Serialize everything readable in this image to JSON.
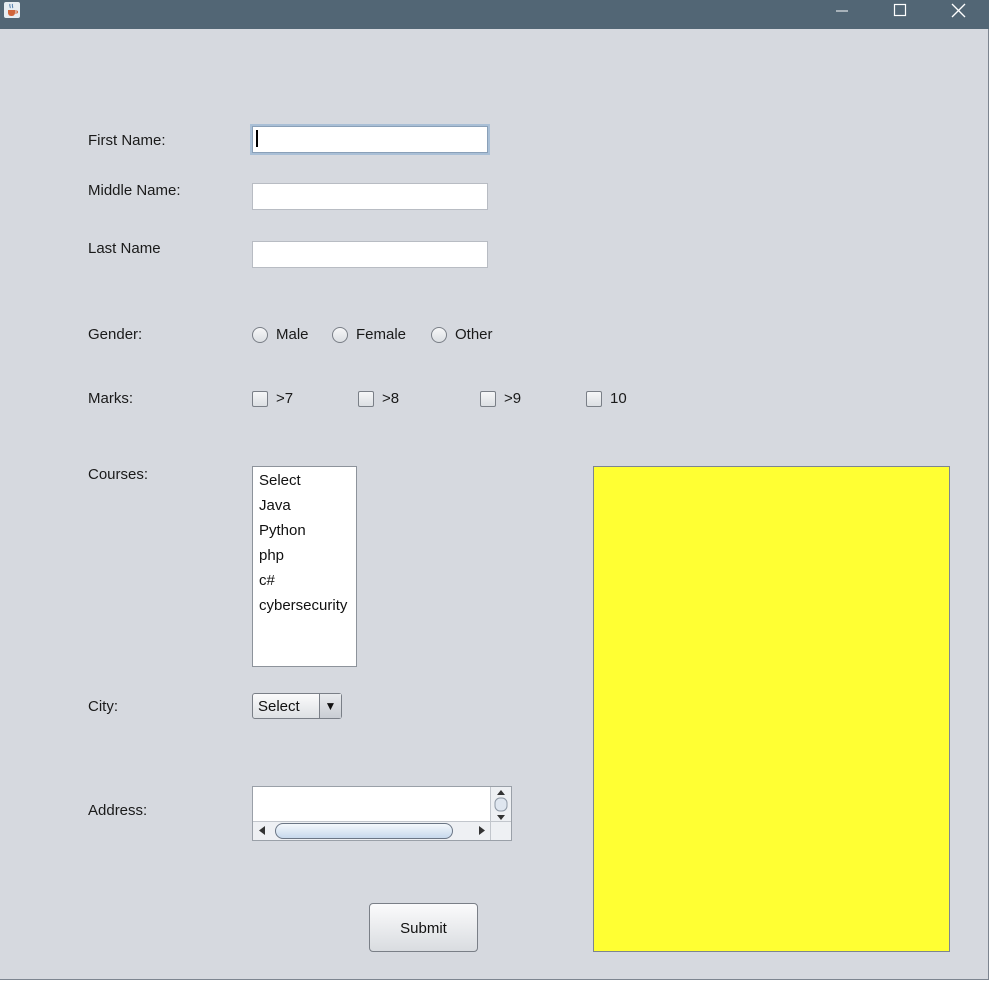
{
  "form": {
    "first_name_label": "First Name:",
    "middle_name_label": "Middle Name:",
    "last_name_label": "Last Name",
    "first_name_value": "",
    "middle_name_value": "",
    "last_name_value": "",
    "gender_label": "Gender:",
    "gender_options": [
      "Male",
      "Female",
      "Other"
    ],
    "marks_label": "Marks:",
    "marks_options": [
      ">7",
      ">8",
      ">9",
      "10"
    ],
    "courses_label": "Courses:",
    "courses": [
      "Select",
      "Java",
      "Python",
      "php",
      "c#",
      "cybersecurity"
    ],
    "city_label": "City:",
    "city_selected": "Select",
    "address_label": "Address:",
    "address_value": "",
    "submit_label": "Submit"
  },
  "colors": {
    "titlebar": "#526675",
    "window_bg": "#d6d9df",
    "output_panel": "#ffff33"
  },
  "icons": {
    "app": "java-cup-icon",
    "minimize": "minimize-icon",
    "maximize": "maximize-icon",
    "close": "close-icon",
    "combo_arrow": "triangle-down-icon"
  }
}
